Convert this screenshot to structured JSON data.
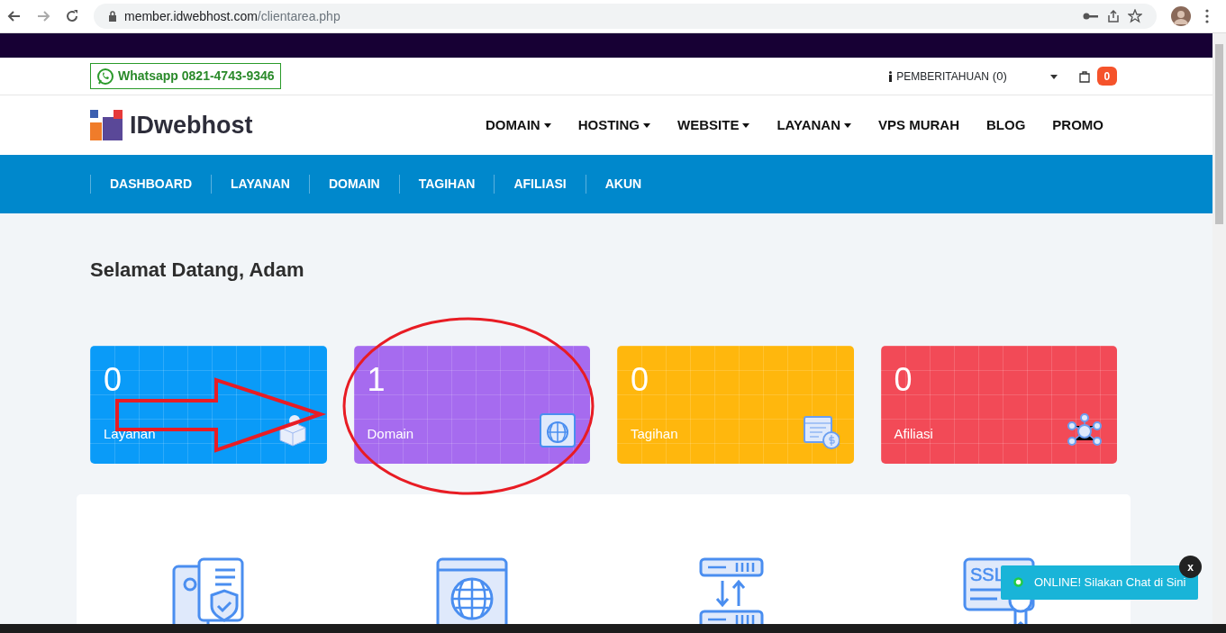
{
  "browser": {
    "url_host": "member.idwebhost.com",
    "url_path": "/clientarea.php"
  },
  "topbar": {
    "whatsapp": "Whatsapp 0821-4743-9346",
    "notifications": "PEMBERITAHUAN",
    "notification_count": "(0)",
    "cart_count": "0"
  },
  "navbar": {
    "logo": "IDwebhost",
    "items": [
      {
        "label": "DOMAIN",
        "dropdown": true
      },
      {
        "label": "HOSTING",
        "dropdown": true
      },
      {
        "label": "WEBSITE",
        "dropdown": true
      },
      {
        "label": "LAYANAN",
        "dropdown": true
      },
      {
        "label": "VPS MURAH",
        "dropdown": false
      },
      {
        "label": "BLOG",
        "dropdown": false
      },
      {
        "label": "PROMO",
        "dropdown": false
      }
    ]
  },
  "subnav": [
    "DASHBOARD",
    "LAYANAN",
    "DOMAIN",
    "TAGIHAN",
    "AFILIASI",
    "AKUN"
  ],
  "greeting": "Selamat Datang, Adam",
  "stats": [
    {
      "count": "0",
      "label": "Layanan",
      "kind": "box",
      "color": "#0a9bf8"
    },
    {
      "count": "1",
      "label": "Domain",
      "kind": "globe",
      "color": "#a66bef"
    },
    {
      "count": "0",
      "label": "Tagihan",
      "kind": "calendar",
      "color": "#ffb70d"
    },
    {
      "count": "0",
      "label": "Afiliasi",
      "kind": "network",
      "color": "#f24a57"
    }
  ],
  "features": [
    {
      "kind": "server"
    },
    {
      "kind": "globe"
    },
    {
      "kind": "transfer"
    },
    {
      "kind": "ssl",
      "icon_text": "SSL"
    }
  ],
  "chat": {
    "text": "ONLINE! Silakan Chat di Sini",
    "close": "x"
  }
}
